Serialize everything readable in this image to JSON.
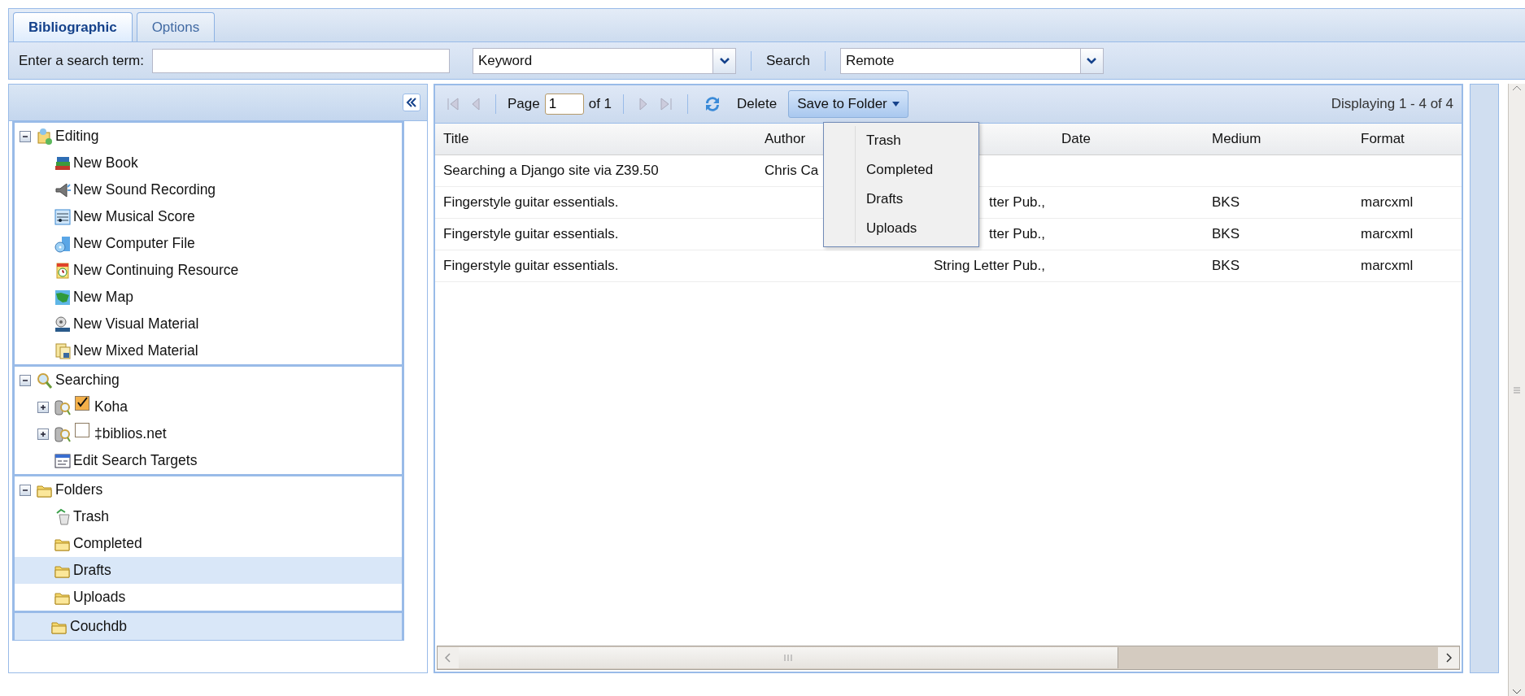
{
  "tabs": [
    {
      "label": "Bibliographic",
      "selected": true
    },
    {
      "label": "Options",
      "selected": false
    }
  ],
  "search_bar": {
    "label": "Enter a search term:",
    "search_type": "Keyword",
    "search_label": "Search",
    "target": "Remote"
  },
  "sidebar": {
    "sections": [
      {
        "label": "Editing",
        "kind": "editing",
        "expanded": true,
        "selected": false,
        "children": [
          {
            "label": "New Book",
            "kind": "book",
            "selected": false
          },
          {
            "label": "New Sound Recording",
            "kind": "sound",
            "selected": false
          },
          {
            "label": "New Musical Score",
            "kind": "score",
            "selected": false
          },
          {
            "label": "New Computer File",
            "kind": "computer",
            "selected": false
          },
          {
            "label": "New Continuing Resource",
            "kind": "continuing",
            "selected": false
          },
          {
            "label": "New Map",
            "kind": "map",
            "selected": false
          },
          {
            "label": "New Visual Material",
            "kind": "visual",
            "selected": false
          },
          {
            "label": "New Mixed Material",
            "kind": "mixed",
            "selected": false
          }
        ]
      },
      {
        "label": "Searching",
        "kind": "searching",
        "expanded": true,
        "selected": false,
        "children": [
          {
            "label": "Koha",
            "kind": "target",
            "expanded": false,
            "checked": true,
            "selected": false
          },
          {
            "label": "‡biblios.net",
            "kind": "target",
            "expanded": false,
            "checked": false,
            "selected": false
          },
          {
            "label": "Edit Search Targets",
            "kind": "edit",
            "selected": false
          }
        ]
      },
      {
        "label": "Folders",
        "kind": "folder",
        "expanded": true,
        "selected": false,
        "children": [
          {
            "label": "Trash",
            "kind": "trash",
            "selected": false
          },
          {
            "label": "Completed",
            "kind": "folder",
            "selected": false
          },
          {
            "label": "Drafts",
            "kind": "folder",
            "selected": true
          },
          {
            "label": "Uploads",
            "kind": "folder",
            "selected": false
          }
        ]
      },
      {
        "label": "Couchdb",
        "kind": "folder",
        "selected": true
      }
    ]
  },
  "grid": {
    "toolbar": {
      "page_label": "Page",
      "page": "1",
      "page_count": "of 1",
      "delete": "Delete",
      "save": "Save to Folder",
      "status": "Displaying 1 - 4 of 4"
    },
    "menu": [
      "Trash",
      "Completed",
      "Drafts",
      "Uploads"
    ],
    "columns": [
      "Title",
      "Author",
      null,
      "Date",
      "Medium",
      "Format"
    ],
    "rows": [
      [
        "Searching a Django site via Z39.50",
        "Chris Ca",
        null,
        null,
        null,
        null
      ],
      [
        "Fingerstyle guitar essentials.",
        null,
        "tter Pub.,",
        null,
        "BKS",
        "marcxml"
      ],
      [
        "Fingerstyle guitar essentials.",
        null,
        "tter Pub.,",
        null,
        "BKS",
        "marcxml"
      ],
      [
        "Fingerstyle guitar essentials.",
        null,
        "String Letter Pub.,",
        null,
        "BKS",
        "marcxml"
      ]
    ]
  }
}
